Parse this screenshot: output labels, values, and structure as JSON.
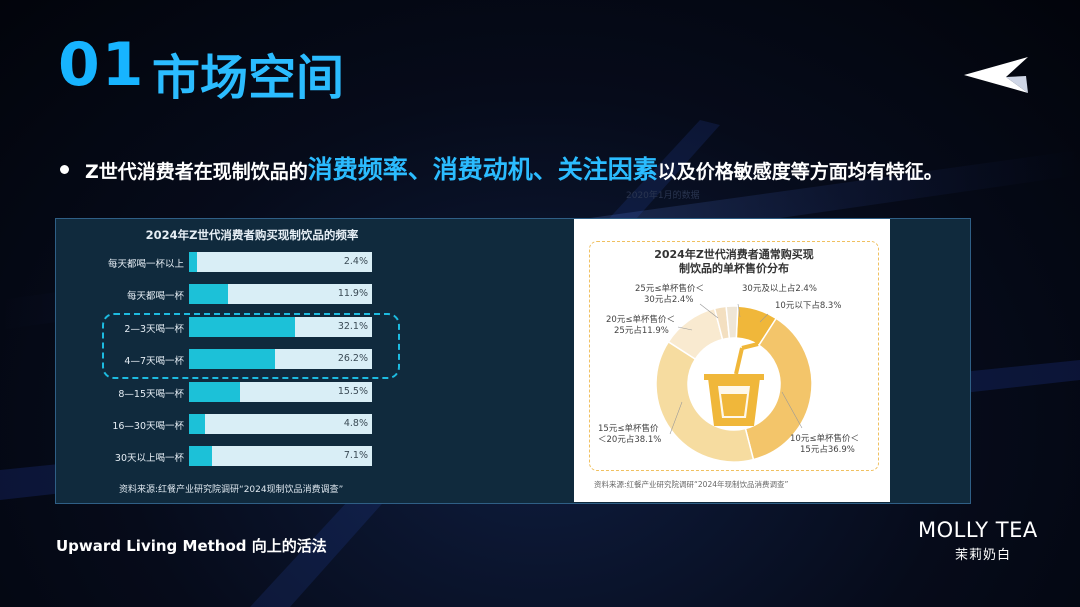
{
  "header": {
    "number": "01",
    "title": "市场空间"
  },
  "bullet": {
    "prefix": "Z世代消费者在现制饮品的",
    "highlight": "消费频率、消费动机、关注因素",
    "suffix": "以及价格敏感度等方面均有特征。"
  },
  "stray_text": "2020年1月的数据",
  "colors": {
    "accent": "#2bbcff",
    "bar_fill": "#1cc1d8",
    "bar_track": "#d9eef6",
    "donut_main": "#f0b73a",
    "donut_light": "#f6e2b6"
  },
  "chart_data": [
    {
      "type": "bar",
      "orientation": "horizontal",
      "title": "2024年Z世代消费者购买现制饮品的频率",
      "categories": [
        "每天都喝一杯以上",
        "每天都喝一杯",
        "2—3天喝一杯",
        "4—7天喝一杯",
        "8—15天喝一杯",
        "16—30天喝一杯",
        "30天以上喝一杯"
      ],
      "values": [
        2.4,
        11.9,
        32.1,
        26.2,
        15.5,
        4.8,
        7.1
      ],
      "value_labels": [
        "2.4%",
        "11.9%",
        "32.1%",
        "26.2%",
        "15.5%",
        "4.8%",
        "7.1%"
      ],
      "xlim": [
        0,
        100
      ],
      "highlighted": [
        "2—3天喝一杯",
        "4—7天喝一杯"
      ],
      "source": "资料来源:红餐产业研究院调研“2024现制饮品消费调查”"
    },
    {
      "type": "pie",
      "variant": "donut",
      "title": "2024年Z世代消费者通常购买现制饮品的单杯售价分布",
      "slices": [
        {
          "label": "10元以下占8.3%",
          "value": 8.3
        },
        {
          "label": "10元≤单杯售价＜15元占36.9%",
          "value": 36.9
        },
        {
          "label": "15元≤单杯售价＜20元占38.1%",
          "value": 38.1
        },
        {
          "label": "20元≤单杯售价＜25元占11.9%",
          "value": 11.9
        },
        {
          "label": "25元≤单杯售价＜30元占2.4%",
          "value": 2.4
        },
        {
          "label": "30元及以上占2.4%",
          "value": 2.4
        }
      ],
      "label_lines": {
        "l1": "30元及以上占2.4%",
        "l2a": "25元≤单杯售价＜",
        "l2b": "30元占2.4%",
        "l3a": "20元≤单杯售价＜",
        "l3b": "25元占11.9%",
        "l4": "10元以下占8.3%",
        "l5a": "15元≤单杯售价",
        "l5b": "＜20元占38.1%",
        "l6a": "10元≤单杯售价＜",
        "l6b": "15元占36.9%"
      },
      "source": "资料来源:红餐产业研究院调研“2024年现制饮品消费调查”"
    }
  ],
  "footer": {
    "slogan": "Upward Living Method 向上的活法",
    "brand_en": "MOLLY TEA",
    "brand_cn": "茉莉奶白"
  }
}
